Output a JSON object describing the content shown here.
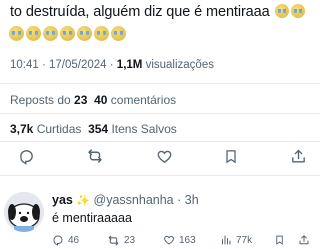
{
  "tweet": {
    "text_line1": "to destruída, alguém diz que é mentiraaa",
    "emoji_line1": [
      "crying-face-emoji",
      "crying-face-emoji"
    ],
    "emoji_line2": [
      "crying-face-emoji",
      "crying-face-emoji",
      "crying-face-emoji",
      "crying-face-emoji",
      "crying-face-emoji",
      "crying-face-emoji",
      "crying-face-emoji"
    ],
    "time": "10:41 · 17/05/2024 ·",
    "views_count": "1,1M",
    "views_label": "visualizações"
  },
  "stats": {
    "reposts_label": "Reposts do",
    "reposts_count": "23",
    "comments_count": "40",
    "comments_label": "comentários",
    "likes_count": "3,7k",
    "likes_label": "Curtidas",
    "saves_count": "354",
    "saves_label": "Itens Salvos"
  },
  "actions": [
    "reply-icon",
    "repost-icon",
    "like-icon",
    "bookmark-icon",
    "share-icon"
  ],
  "reply": {
    "name": "yas",
    "badge_emoji": "sparkle-emoji",
    "handle": "@yassnhanha · 3h",
    "text": "é mentiraaaaa",
    "reply_count": "46",
    "repost_count": "23",
    "like_count": "163",
    "views_count": "77k"
  },
  "colors": {
    "text": "#0f1419",
    "secondary": "#536471",
    "divider": "#e6ecf0"
  }
}
